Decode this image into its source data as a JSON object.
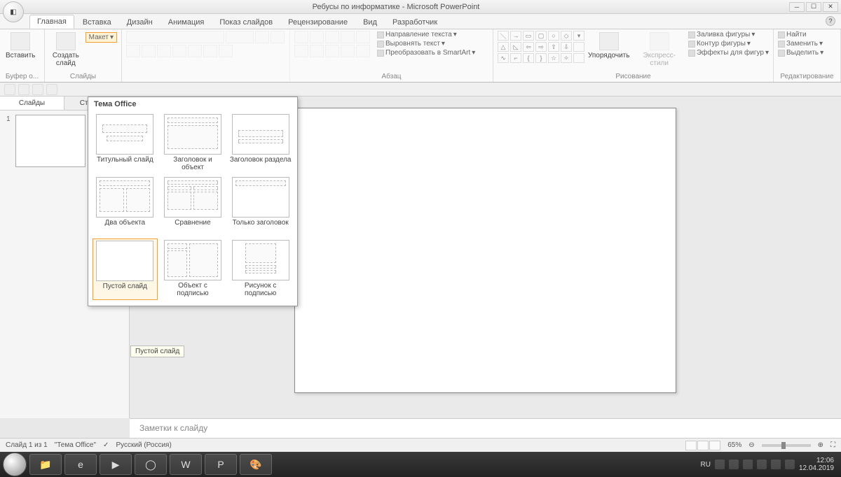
{
  "window": {
    "title": "Ребусы по информатике - Microsoft PowerPoint"
  },
  "tabs": {
    "home": "Главная",
    "insert": "Вставка",
    "design": "Дизайн",
    "animation": "Анимация",
    "slideshow": "Показ слайдов",
    "review": "Рецензирование",
    "view": "Вид",
    "developer": "Разработчик"
  },
  "ribbon": {
    "paste": "Вставить",
    "clipboard_label": "Буфер о...",
    "new_slide": "Создать слайд",
    "layout_btn": "Макет",
    "slides_label": "Слайды",
    "paragraph_label": "Абзац",
    "text_direction": "Направление текста",
    "align_text": "Выровнять текст",
    "convert_smartart": "Преобразовать в SmartArt",
    "arrange": "Упорядочить",
    "quick_styles": "Экспресс-стили",
    "drawing_label": "Рисование",
    "shape_fill": "Заливка фигуры",
    "shape_outline": "Контур фигуры",
    "shape_effects": "Эффекты для фигур",
    "find": "Найти",
    "replace": "Заменить",
    "select": "Выделить",
    "editing_label": "Редактирование"
  },
  "sidepanel": {
    "slides_tab": "Слайды",
    "outline_tab": "Структура",
    "slide_num": "1"
  },
  "layout_popup": {
    "theme_title": "Тема Office",
    "items": [
      "Титульный слайд",
      "Заголовок и объект",
      "Заголовок раздела",
      "Два объекта",
      "Сравнение",
      "Только заголовок",
      "Пустой слайд",
      "Объект с подписью",
      "Рисунок с подписью"
    ],
    "tooltip": "Пустой слайд"
  },
  "notes": {
    "placeholder": "Заметки к слайду"
  },
  "status": {
    "slide_info": "Слайд 1 из 1",
    "theme": "\"Тема Office\"",
    "language": "Русский (Россия)",
    "zoom": "65%"
  },
  "tray": {
    "lang": "RU",
    "time": "12:06",
    "date": "12.04.2019"
  }
}
